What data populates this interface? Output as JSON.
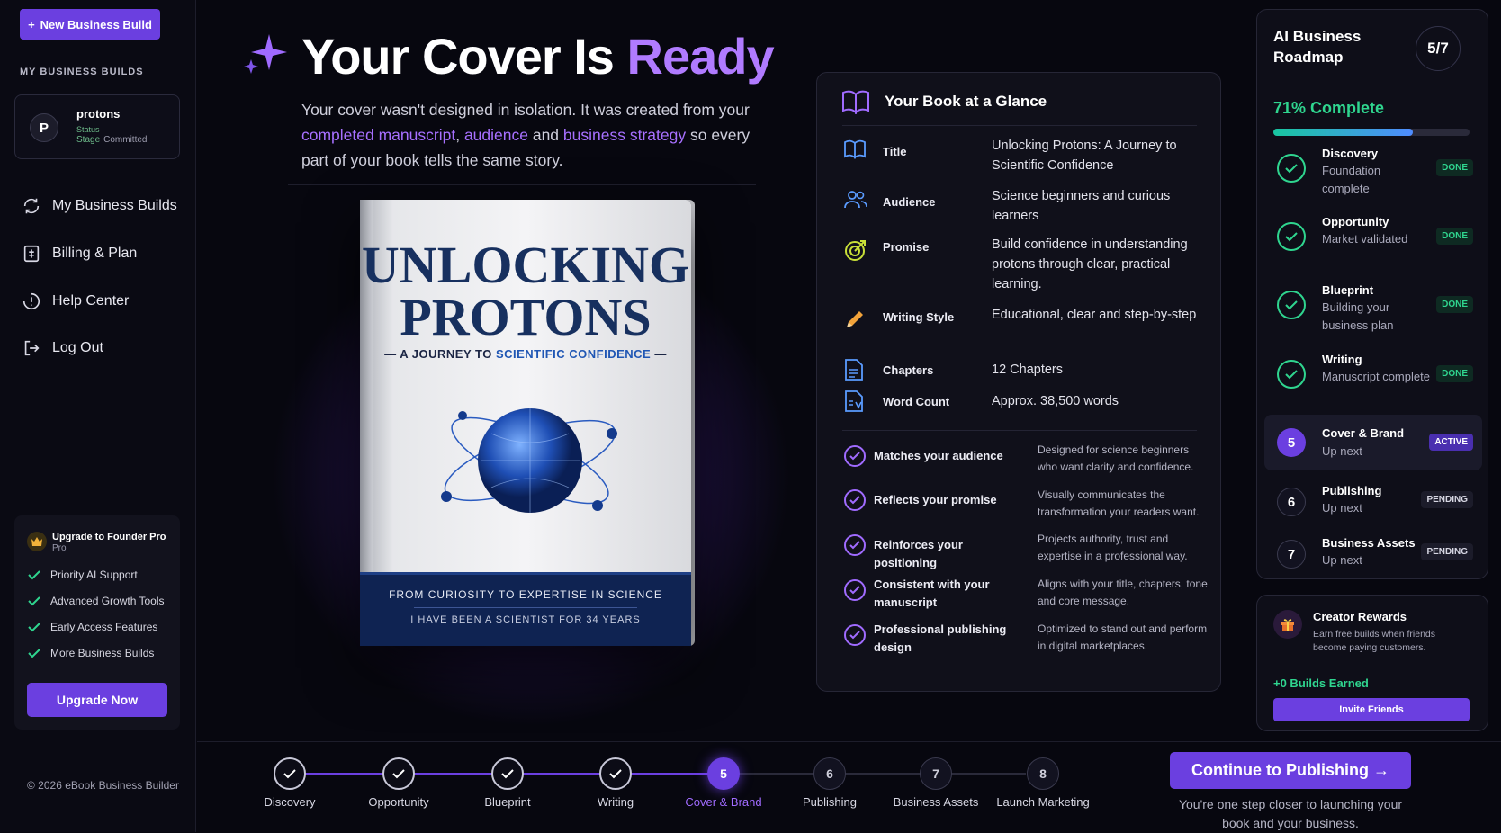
{
  "sidebar": {
    "new_build": "New Business Build",
    "section": "MY BUSINESS BUILDS",
    "project": {
      "avatar": "P",
      "name": "protons",
      "status_line": "Status",
      "status_label": "Stage",
      "status_value": "Committed"
    },
    "nav": [
      {
        "label": "My Business Builds",
        "icon": "refresh-icon"
      },
      {
        "label": "Billing & Plan",
        "icon": "billing-icon"
      },
      {
        "label": "Help Center",
        "icon": "help-icon"
      },
      {
        "label": "Log Out",
        "icon": "logout-icon"
      }
    ],
    "upgrade": {
      "title": "Upgrade to Founder Pro",
      "subtitle": "Pro",
      "features": [
        "Priority AI Support",
        "Advanced Growth Tools",
        "Early Access Features",
        "More Business Builds"
      ],
      "button": "Upgrade Now"
    },
    "copyright": "© 2026 eBook Business Builder"
  },
  "hero": {
    "title_prefix": "Your Cover Is ",
    "title_highlight": "Ready",
    "intro_1": "Your cover wasn't designed in isolation. It was created from your ",
    "intro_link_1": "completed manuscript",
    "intro_comma": ", ",
    "intro_link_2": "audience",
    "intro_and": " and ",
    "intro_link_3": "business strategy",
    "intro_2": " so every part of your book tells the same story."
  },
  "book": {
    "title_line1": "UNLOCKING",
    "title_line2": "PROTONS",
    "subtitle_prefix": "— A JOURNEY TO ",
    "subtitle_highlight": "SCIENTIFIC CONFIDENCE",
    "subtitle_suffix": " —",
    "band_line1": "FROM CURIOSITY TO EXPERTISE IN SCIENCE",
    "band_line2": "I HAVE BEEN A SCIENTIST FOR 34 YEARS"
  },
  "glance": {
    "heading": "Your Book at a Glance",
    "rows": [
      {
        "label": "Title",
        "value": "Unlocking Protons: A Journey to Scientific Confidence",
        "icon": "book-icon"
      },
      {
        "label": "Audience",
        "value": "Science beginners and curious learners",
        "icon": "audience-icon"
      },
      {
        "label": "Promise",
        "value": "Build confidence in understanding protons through clear, practical learning.",
        "icon": "target-icon"
      },
      {
        "label": "Writing Style",
        "value": "Educational, clear and step-by-step",
        "icon": "pencil-icon"
      },
      {
        "label": "Chapters",
        "value": "12 Chapters",
        "icon": "document-icon"
      },
      {
        "label": "Word Count",
        "value": "Approx. 38,500 words",
        "icon": "wordcount-icon"
      }
    ],
    "checks": [
      {
        "label": "Matches your audience",
        "desc": "Designed for science beginners who want clarity and confidence."
      },
      {
        "label": "Reflects your promise",
        "desc": "Visually communicates the transformation your readers want."
      },
      {
        "label": "Reinforces your positioning",
        "desc": "Projects authority, trust and expertise in a professional way."
      },
      {
        "label": "Consistent with your manuscript",
        "desc": "Aligns with your title, chapters, tone and core message."
      },
      {
        "label": "Professional publishing design",
        "desc": "Optimized to stand out and perform in digital marketplaces."
      }
    ]
  },
  "roadmap": {
    "title": "AI Business Roadmap",
    "count": "5/7",
    "percent_label": "71% Complete",
    "progress": 0.71,
    "steps": [
      {
        "num": "",
        "name": "Discovery",
        "desc": "Foundation complete",
        "badge": "DONE",
        "state": "done"
      },
      {
        "num": "",
        "name": "Opportunity",
        "desc": "Market validated",
        "badge": "DONE",
        "state": "done"
      },
      {
        "num": "",
        "name": "Blueprint",
        "desc": "Building your business plan",
        "badge": "DONE",
        "state": "done"
      },
      {
        "num": "",
        "name": "Writing",
        "desc": "Manuscript complete",
        "badge": "DONE",
        "state": "done"
      },
      {
        "num": "5",
        "name": "Cover & Brand",
        "desc": "Up next",
        "badge": "ACTIVE",
        "state": "active"
      },
      {
        "num": "6",
        "name": "Publishing",
        "desc": "Up next",
        "badge": "PENDING",
        "state": "pending"
      },
      {
        "num": "7",
        "name": "Business Assets",
        "desc": "Up next",
        "badge": "PENDING",
        "state": "pending"
      }
    ]
  },
  "rewards": {
    "title": "Creator Rewards",
    "desc": "Earn free builds when friends become paying customers.",
    "earned": "+0 Builds Earned",
    "button": "Invite Friends"
  },
  "stepper": {
    "steps": [
      {
        "num": "",
        "label": "Discovery",
        "state": "done"
      },
      {
        "num": "",
        "label": "Opportunity",
        "state": "done"
      },
      {
        "num": "",
        "label": "Blueprint",
        "state": "done"
      },
      {
        "num": "",
        "label": "Writing",
        "state": "done"
      },
      {
        "num": "5",
        "label": "Cover & Brand",
        "state": "current"
      },
      {
        "num": "6",
        "label": "Publishing",
        "state": "pending"
      },
      {
        "num": "7",
        "label": "Business Assets",
        "state": "pending"
      },
      {
        "num": "8",
        "label": "Launch Marketing",
        "state": "pending"
      }
    ],
    "continue_button": "Continue to Publishing →",
    "continue_note": "You're one step closer to launching your book and your business."
  },
  "colors": {
    "accent": "#6b3fe0",
    "highlight": "#b07bff",
    "success": "#2fd58f"
  }
}
